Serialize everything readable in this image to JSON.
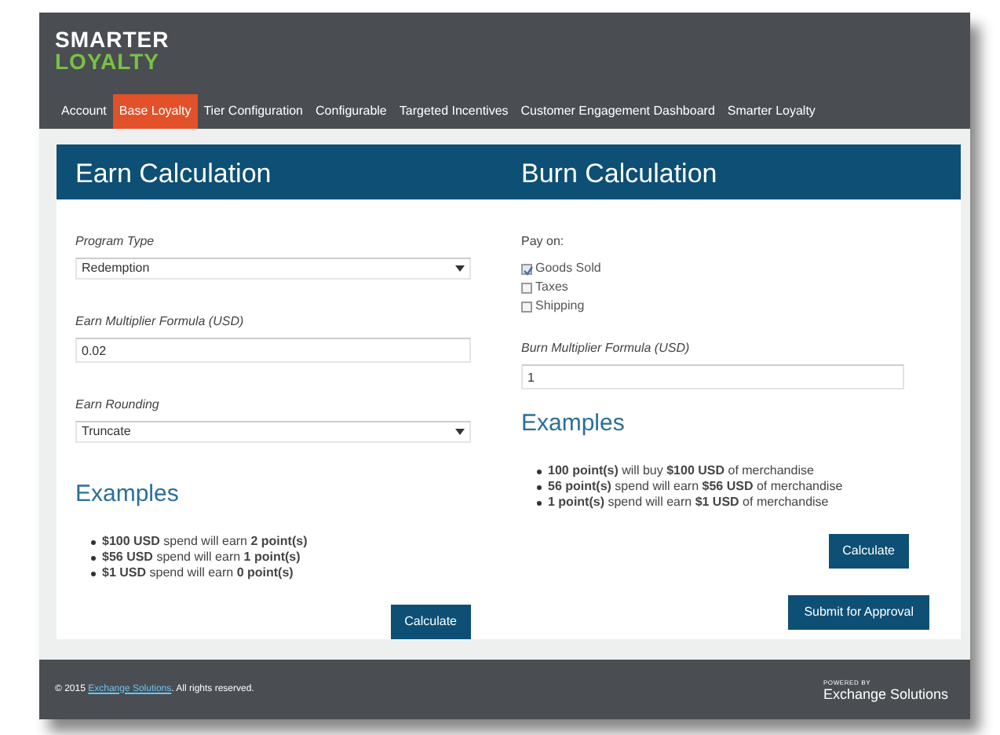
{
  "logo": {
    "line1": "SMARTER",
    "line2": "LOYALTY"
  },
  "nav": [
    {
      "label": "Account",
      "selected": false
    },
    {
      "label": "Base Loyalty",
      "selected": true
    },
    {
      "label": "Tier Configuration",
      "selected": false
    },
    {
      "label": "Configurable",
      "selected": false
    },
    {
      "label": "Targeted Incentives",
      "selected": false
    },
    {
      "label": "Customer Engagement Dashboard",
      "selected": false
    },
    {
      "label": "Smarter Loyalty",
      "selected": false
    }
  ],
  "earn": {
    "title": "Earn Calculation",
    "fields": [
      {
        "kind": "select",
        "label": "Program Type",
        "value": "Redemption"
      },
      {
        "kind": "input",
        "label": "Earn Multiplier Formula (USD)",
        "value": "0.02"
      },
      {
        "kind": "select",
        "label": "Earn Rounding",
        "value": "Truncate"
      }
    ],
    "examples_title": "Examples",
    "examples": [
      "**$100 USD** spend will earn **2 point(s)**",
      "**$56 USD** spend will earn **1 point(s)**",
      "**$1 USD** spend will earn **0 point(s)**"
    ],
    "buttons": [
      "Calculate"
    ]
  },
  "burn": {
    "title": "Burn Calculation",
    "pay_on": "Pay on:",
    "options": [
      {
        "label": "Goods Sold",
        "checked": true
      },
      {
        "label": "Taxes",
        "checked": false
      },
      {
        "label": "Shipping",
        "checked": false
      }
    ],
    "fields": [
      {
        "kind": "input",
        "label": "Burn Multiplier Formula (USD)",
        "value": "1"
      }
    ],
    "examples_title": "Examples",
    "examples": [
      "**100 point(s)** will buy **$100 USD** of merchandise",
      "**56 point(s)** spend will earn **$56 USD** of merchandise",
      "**1 point(s)** spend will earn **$1 USD** of merchandise"
    ],
    "buttons": [
      "Calculate",
      "Submit for Approval"
    ]
  },
  "footer": {
    "copyright": "© 2015",
    "link": "Exchange Solutions",
    "rights": ". All rights reserved.",
    "powered_by": "POWERED BY",
    "brand": "Exchange Solutions"
  }
}
